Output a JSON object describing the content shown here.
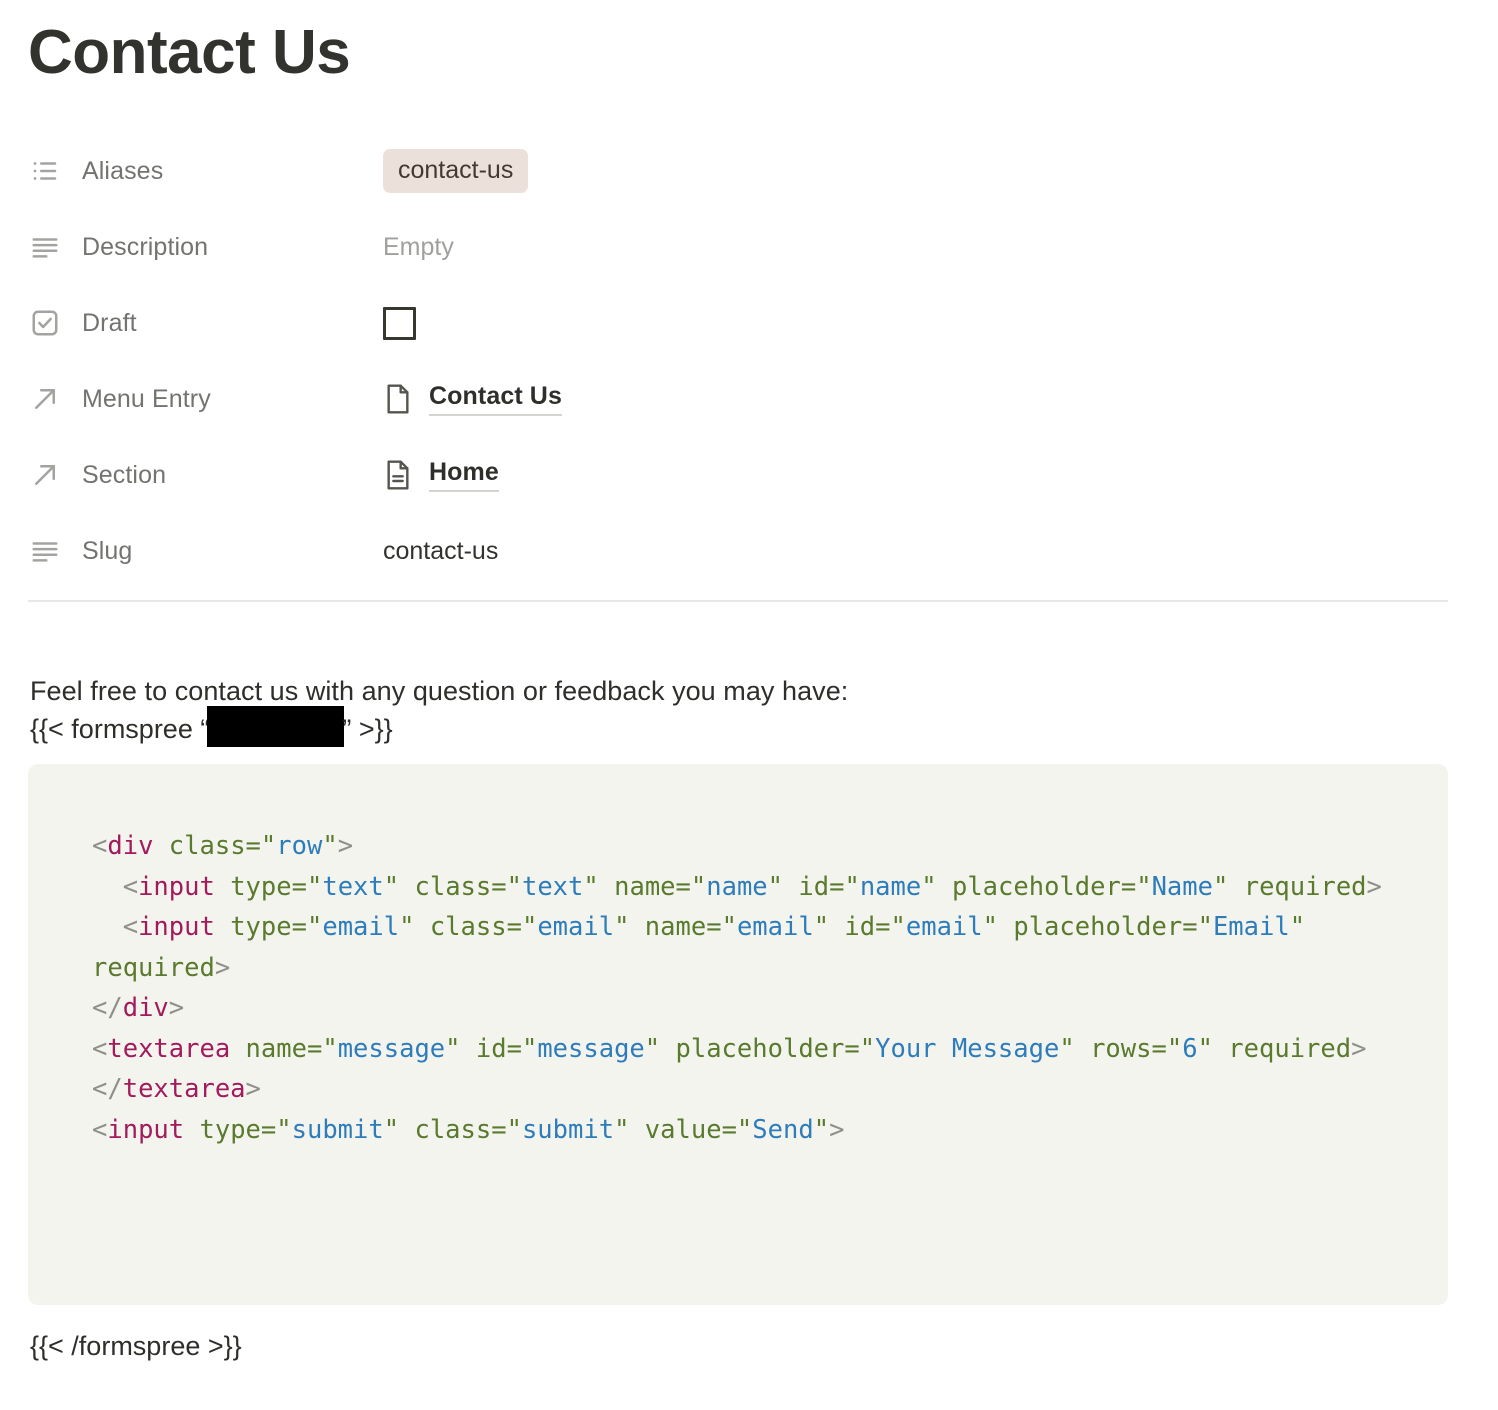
{
  "note": {
    "title": "Contact Us"
  },
  "properties": [
    {
      "icon": "list-bullet-icon",
      "label": "Aliases",
      "type": "tag",
      "value": "contact-us"
    },
    {
      "icon": "text-lines-icon",
      "label": "Description",
      "type": "empty",
      "value": "Empty"
    },
    {
      "icon": "checkbox-checked-icon",
      "label": "Draft",
      "type": "checkbox",
      "value": "unchecked"
    },
    {
      "icon": "arrow-up-right-icon",
      "label": "Menu Entry",
      "type": "link",
      "value": "Contact Us",
      "value_icon": "page-blank-icon"
    },
    {
      "icon": "arrow-up-right-icon",
      "label": "Section",
      "type": "link",
      "value": "Home",
      "value_icon": "page-lines-icon"
    },
    {
      "icon": "text-lines-icon",
      "label": "Slug",
      "type": "text",
      "value": "contact-us"
    }
  ],
  "body": {
    "paragraph": "Feel free to contact us with any question or feedback you may have:",
    "shortcode_open_prefix": "{{< formspree “",
    "shortcode_open_suffix": "” >}}",
    "shortcode_redacted": "",
    "shortcode_close": "{{< /formspree >}}"
  },
  "code_block": {
    "language": "html",
    "background": "#f4f4ef",
    "lines": [
      {
        "tokens": [
          {
            "t": "<",
            "c": "punct"
          },
          {
            "t": "div",
            "c": "tag"
          },
          {
            "t": " ",
            "c": "plain"
          },
          {
            "t": "class",
            "c": "attr"
          },
          {
            "t": "=",
            "c": "attr"
          },
          {
            "t": "\"",
            "c": "quote"
          },
          {
            "t": "row",
            "c": "val"
          },
          {
            "t": "\"",
            "c": "quote"
          },
          {
            "t": ">",
            "c": "punct"
          }
        ]
      },
      {
        "tokens": [
          {
            "t": "  <",
            "c": "punct"
          },
          {
            "t": "input",
            "c": "tag"
          },
          {
            "t": " ",
            "c": "plain"
          },
          {
            "t": "type",
            "c": "attr"
          },
          {
            "t": "=",
            "c": "attr"
          },
          {
            "t": "\"",
            "c": "quote"
          },
          {
            "t": "text",
            "c": "val"
          },
          {
            "t": "\"",
            "c": "quote"
          },
          {
            "t": " ",
            "c": "plain"
          },
          {
            "t": "class",
            "c": "attr"
          },
          {
            "t": "=",
            "c": "attr"
          },
          {
            "t": "\"",
            "c": "quote"
          },
          {
            "t": "text",
            "c": "val"
          },
          {
            "t": "\"",
            "c": "quote"
          },
          {
            "t": " ",
            "c": "plain"
          },
          {
            "t": "name",
            "c": "attr"
          },
          {
            "t": "=",
            "c": "attr"
          },
          {
            "t": "\"",
            "c": "quote"
          },
          {
            "t": "name",
            "c": "val"
          },
          {
            "t": "\"",
            "c": "quote"
          },
          {
            "t": " ",
            "c": "plain"
          },
          {
            "t": "id",
            "c": "attr"
          },
          {
            "t": "=",
            "c": "attr"
          },
          {
            "t": "\"",
            "c": "quote"
          },
          {
            "t": "name",
            "c": "val"
          },
          {
            "t": "\"",
            "c": "quote"
          },
          {
            "t": " ",
            "c": "plain"
          },
          {
            "t": "placeholder",
            "c": "attr"
          },
          {
            "t": "=",
            "c": "attr"
          },
          {
            "t": "\"",
            "c": "quote"
          },
          {
            "t": "Name",
            "c": "val"
          },
          {
            "t": "\"",
            "c": "quote"
          },
          {
            "t": " ",
            "c": "plain"
          },
          {
            "t": "required",
            "c": "attr"
          },
          {
            "t": ">",
            "c": "punct"
          }
        ]
      },
      {
        "tokens": [
          {
            "t": "  <",
            "c": "punct"
          },
          {
            "t": "input",
            "c": "tag"
          },
          {
            "t": " ",
            "c": "plain"
          },
          {
            "t": "type",
            "c": "attr"
          },
          {
            "t": "=",
            "c": "attr"
          },
          {
            "t": "\"",
            "c": "quote"
          },
          {
            "t": "email",
            "c": "val"
          },
          {
            "t": "\"",
            "c": "quote"
          },
          {
            "t": " ",
            "c": "plain"
          },
          {
            "t": "class",
            "c": "attr"
          },
          {
            "t": "=",
            "c": "attr"
          },
          {
            "t": "\"",
            "c": "quote"
          },
          {
            "t": "email",
            "c": "val"
          },
          {
            "t": "\"",
            "c": "quote"
          },
          {
            "t": " ",
            "c": "plain"
          },
          {
            "t": "name",
            "c": "attr"
          },
          {
            "t": "=",
            "c": "attr"
          },
          {
            "t": "\"",
            "c": "quote"
          },
          {
            "t": "email",
            "c": "val"
          },
          {
            "t": "\"",
            "c": "quote"
          },
          {
            "t": " ",
            "c": "plain"
          },
          {
            "t": "id",
            "c": "attr"
          },
          {
            "t": "=",
            "c": "attr"
          },
          {
            "t": "\"",
            "c": "quote"
          },
          {
            "t": "email",
            "c": "val"
          },
          {
            "t": "\"",
            "c": "quote"
          },
          {
            "t": " ",
            "c": "plain"
          },
          {
            "t": "placeholder",
            "c": "attr"
          },
          {
            "t": "=",
            "c": "attr"
          },
          {
            "t": "\"",
            "c": "quote"
          },
          {
            "t": "Email",
            "c": "val"
          },
          {
            "t": "\"",
            "c": "quote"
          },
          {
            "t": " ",
            "c": "plain"
          },
          {
            "t": "required",
            "c": "attr"
          },
          {
            "t": ">",
            "c": "punct"
          }
        ]
      },
      {
        "tokens": [
          {
            "t": "</",
            "c": "punct"
          },
          {
            "t": "div",
            "c": "tag"
          },
          {
            "t": ">",
            "c": "punct"
          }
        ]
      },
      {
        "tokens": [
          {
            "t": "<",
            "c": "punct"
          },
          {
            "t": "textarea",
            "c": "tag"
          },
          {
            "t": " ",
            "c": "plain"
          },
          {
            "t": "name",
            "c": "attr"
          },
          {
            "t": "=",
            "c": "attr"
          },
          {
            "t": "\"",
            "c": "quote"
          },
          {
            "t": "message",
            "c": "val"
          },
          {
            "t": "\"",
            "c": "quote"
          },
          {
            "t": " ",
            "c": "plain"
          },
          {
            "t": "id",
            "c": "attr"
          },
          {
            "t": "=",
            "c": "attr"
          },
          {
            "t": "\"",
            "c": "quote"
          },
          {
            "t": "message",
            "c": "val"
          },
          {
            "t": "\"",
            "c": "quote"
          },
          {
            "t": " ",
            "c": "plain"
          },
          {
            "t": "placeholder",
            "c": "attr"
          },
          {
            "t": "=",
            "c": "attr"
          },
          {
            "t": "\"",
            "c": "quote"
          },
          {
            "t": "Your Message",
            "c": "val"
          },
          {
            "t": "\"",
            "c": "quote"
          },
          {
            "t": " ",
            "c": "plain"
          },
          {
            "t": "rows",
            "c": "attr"
          },
          {
            "t": "=",
            "c": "attr"
          },
          {
            "t": "\"",
            "c": "quote"
          },
          {
            "t": "6",
            "c": "val"
          },
          {
            "t": "\"",
            "c": "quote"
          },
          {
            "t": " ",
            "c": "plain"
          },
          {
            "t": "required",
            "c": "attr"
          },
          {
            "t": ">",
            "c": "punct"
          },
          {
            "t": "</",
            "c": "punct"
          },
          {
            "t": "textarea",
            "c": "tag"
          },
          {
            "t": ">",
            "c": "punct"
          }
        ]
      },
      {
        "tokens": [
          {
            "t": "<",
            "c": "punct"
          },
          {
            "t": "input",
            "c": "tag"
          },
          {
            "t": " ",
            "c": "plain"
          },
          {
            "t": "type",
            "c": "attr"
          },
          {
            "t": "=",
            "c": "attr"
          },
          {
            "t": "\"",
            "c": "quote"
          },
          {
            "t": "submit",
            "c": "val"
          },
          {
            "t": "\"",
            "c": "quote"
          },
          {
            "t": " ",
            "c": "plain"
          },
          {
            "t": "class",
            "c": "attr"
          },
          {
            "t": "=",
            "c": "attr"
          },
          {
            "t": "\"",
            "c": "quote"
          },
          {
            "t": "submit",
            "c": "val"
          },
          {
            "t": "\"",
            "c": "quote"
          },
          {
            "t": " ",
            "c": "plain"
          },
          {
            "t": "value",
            "c": "attr"
          },
          {
            "t": "=",
            "c": "attr"
          },
          {
            "t": "\"",
            "c": "quote"
          },
          {
            "t": "Send",
            "c": "val"
          },
          {
            "t": "\"",
            "c": "quote"
          },
          {
            "t": ">",
            "c": "punct"
          }
        ]
      }
    ]
  }
}
